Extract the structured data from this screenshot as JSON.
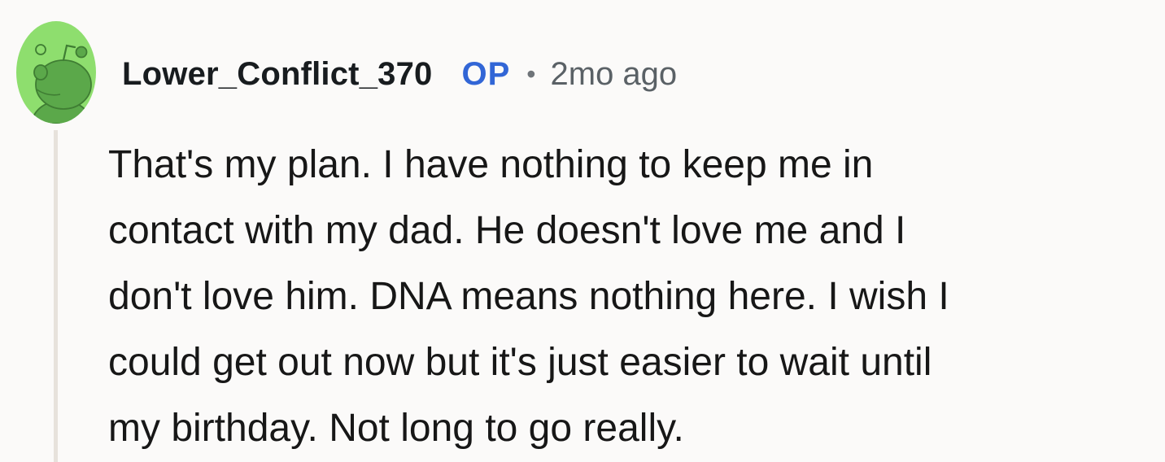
{
  "comment": {
    "username": "Lower_Conflict_370",
    "op_badge": "OP",
    "separator": "•",
    "timestamp": "2mo ago",
    "avatar_icon": "reddit-snoo-avatar-icon",
    "text": "That's my plan. I have nothing to keep me in\ncontact with my dad. He doesn't love me and I\ndon't love him. DNA means nothing here. I wish I\ncould get out now but it's just easier to wait until\nmy birthday. Not long to go really."
  },
  "colors": {
    "background": "#fbfaf9",
    "avatar_bg": "#8ede6e",
    "avatar_figure": "#5ba84a",
    "op_badge": "#3266d6",
    "thread_line": "#e7e2dc"
  }
}
